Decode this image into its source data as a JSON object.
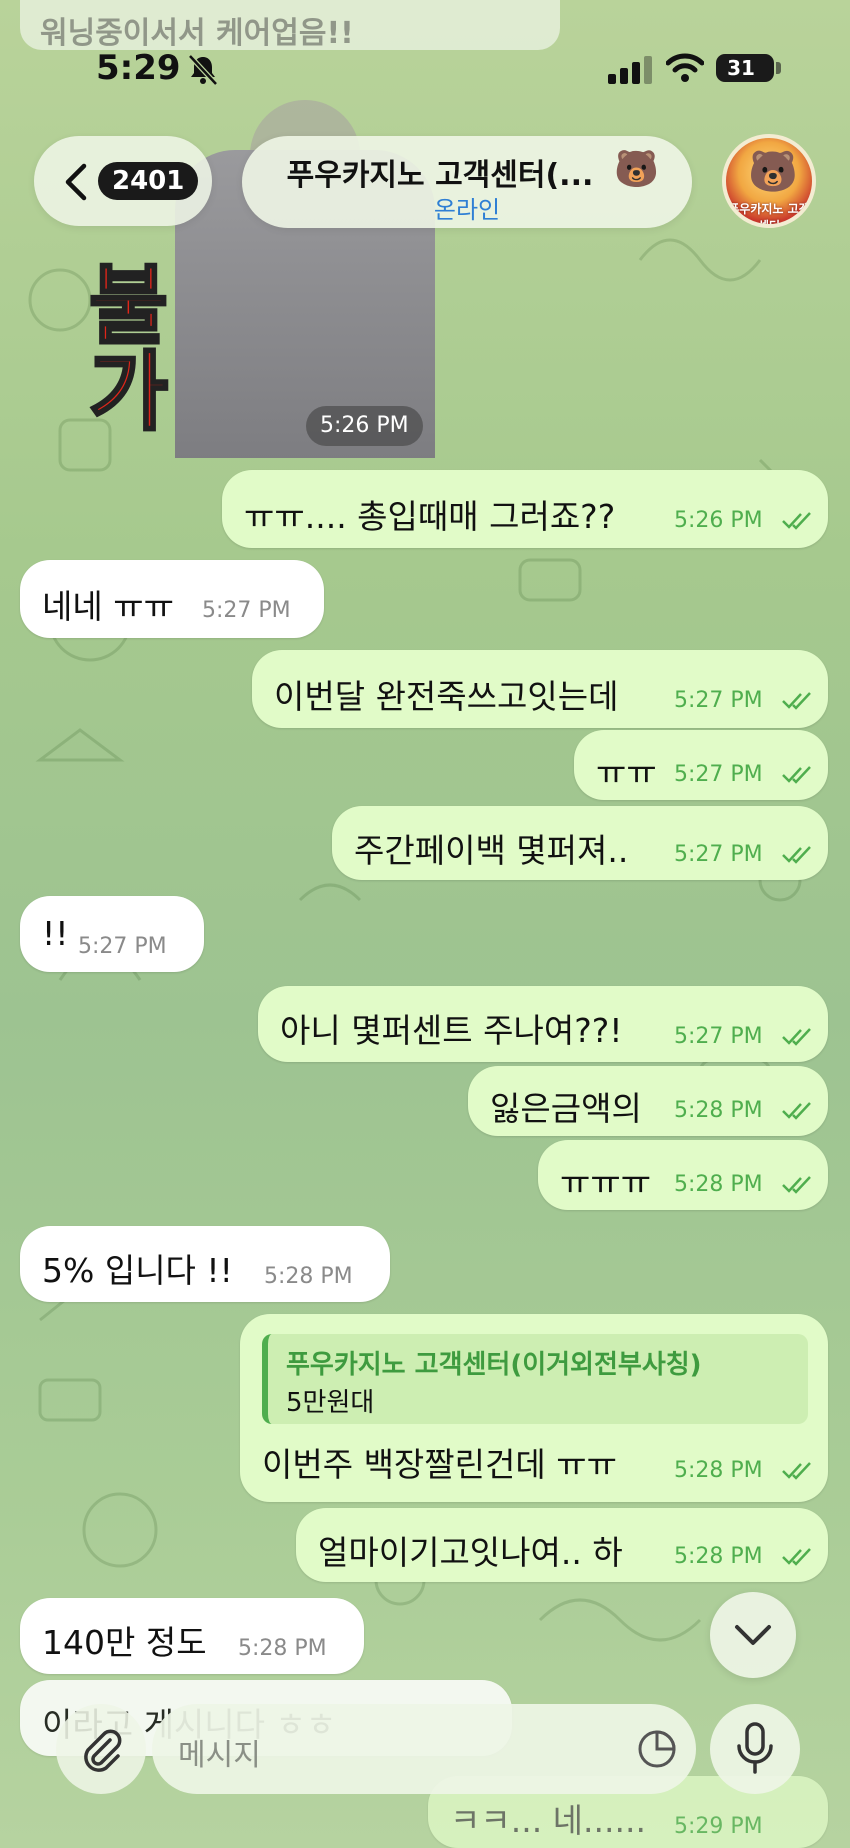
{
  "status_bar": {
    "time": "5:29",
    "battery": "31"
  },
  "header": {
    "back_count": "2401",
    "title": "푸우카지노 고객센터(...",
    "status": "온라인",
    "avatar_label": "푸우카지노 고객센터"
  },
  "top_message": {
    "text": "워닝중이서서 케어업음!!"
  },
  "image_message": {
    "red_text": "불가",
    "time": "5:26 PM"
  },
  "messages": [
    {
      "text": "ㅠㅠ.... 총입때매 그러죠??",
      "time": "5:26 PM"
    },
    {
      "text": "네네 ㅠㅠ",
      "time": "5:27 PM"
    },
    {
      "text": "이번달 완전죽쓰고잇는데",
      "time": "5:27 PM"
    },
    {
      "text": "ㅠㅠ",
      "time": "5:27 PM"
    },
    {
      "text": "주간페이백 몇퍼져..",
      "time": "5:27 PM"
    },
    {
      "text": "!!",
      "time": "5:27 PM"
    },
    {
      "text": "아니 몇퍼센트 주나여??!",
      "time": "5:27 PM"
    },
    {
      "text": "잃은금액의",
      "time": "5:28 PM"
    },
    {
      "text": "ㅠㅠㅠ",
      "time": "5:28 PM"
    },
    {
      "text": "5% 입니다 !!",
      "time": "5:28 PM"
    },
    {
      "reply_name": "푸우카지노 고객센터(이거외전부사칭)",
      "reply_text": "5만원대",
      "text": "이번주 백장짤린건데 ㅠㅠ",
      "time": "5:28 PM"
    },
    {
      "text": "얼마이기고잇나여.. 하",
      "time": "5:28 PM"
    },
    {
      "text": "140만 정도",
      "time": "5:28 PM"
    },
    {
      "text": "이라고 게시니다 ㅎㅎ",
      "time": ""
    },
    {
      "text": "ㅋㅋ... 네......",
      "time": "5:29 PM"
    }
  ],
  "input": {
    "placeholder": "메시지"
  },
  "colors": {
    "outgoing_bubble": "#e1fbc8",
    "incoming_bubble": "#ffffff",
    "time_green": "#4fae4e",
    "link_blue": "#2f7fd4"
  }
}
